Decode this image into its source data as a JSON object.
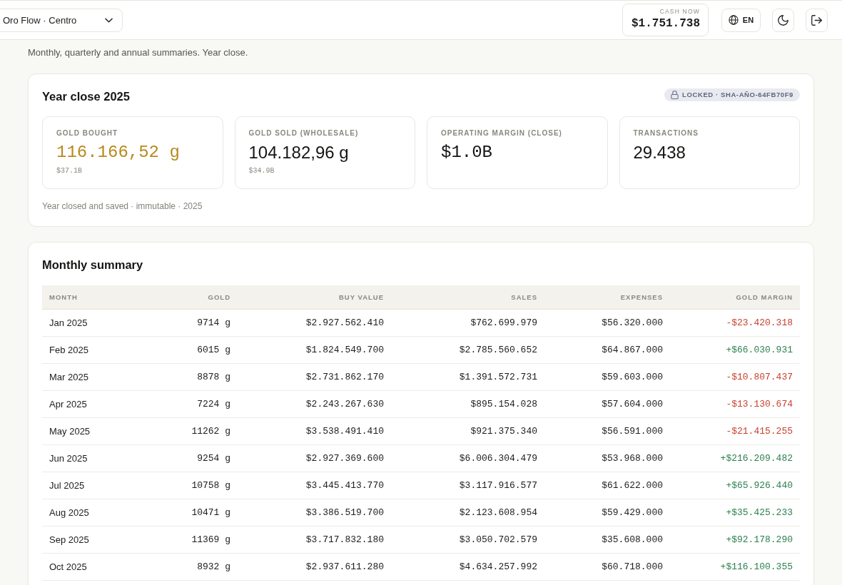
{
  "header": {
    "workspace_selector": "Oro Flow · Centro",
    "cash": {
      "label": "CASH NOW",
      "value": "$1.751.738"
    },
    "language": "EN"
  },
  "subtitle": "Monthly, quarterly and annual summaries. Year close.",
  "year_close": {
    "title": "Year close 2025",
    "lock_status": "LOCKED · SHA-AÑO-64FB70F9",
    "kpis": [
      {
        "kind": "highlight",
        "label": "GOLD BOUGHT",
        "value": "116.166,52 g",
        "sub": "$37.1B"
      },
      {
        "kind": "plain",
        "label": "GOLD SOLD (WHOLESALE)",
        "value": "104.182,96 g",
        "sub": "$34.9B"
      },
      {
        "kind": "money",
        "label": "OPERATING MARGIN (CLOSE)",
        "value": "$1.0B"
      },
      {
        "kind": "plain",
        "label": "TRANSACTIONS",
        "value": "29.438"
      }
    ],
    "note": "Year closed and saved · immutable · 2025"
  },
  "monthly": {
    "title": "Monthly summary",
    "columns": [
      "MONTH",
      "GOLD",
      "BUY VALUE",
      "SALES",
      "EXPENSES",
      "GOLD MARGIN"
    ],
    "rows": [
      {
        "month": "Jan 2025",
        "gold": "9714 g",
        "buy_value": "$2.927.562.410",
        "sales": "$762.699.979",
        "expenses": "$56.320.000",
        "gold_margin": "-$23.420.318",
        "negative": true
      },
      {
        "month": "Feb 2025",
        "gold": "6015 g",
        "buy_value": "$1.824.549.700",
        "sales": "$2.785.560.652",
        "expenses": "$64.867.000",
        "gold_margin": "+$66.030.931",
        "negative": false
      },
      {
        "month": "Mar 2025",
        "gold": "8878 g",
        "buy_value": "$2.731.862.170",
        "sales": "$1.391.572.731",
        "expenses": "$59.603.000",
        "gold_margin": "-$10.807.437",
        "negative": true
      },
      {
        "month": "Apr 2025",
        "gold": "7224 g",
        "buy_value": "$2.243.267.630",
        "sales": "$895.154.028",
        "expenses": "$57.604.000",
        "gold_margin": "-$13.130.674",
        "negative": true
      },
      {
        "month": "May 2025",
        "gold": "11262 g",
        "buy_value": "$3.538.491.410",
        "sales": "$921.375.340",
        "expenses": "$56.591.000",
        "gold_margin": "-$21.415.255",
        "negative": true
      },
      {
        "month": "Jun 2025",
        "gold": "9254 g",
        "buy_value": "$2.927.369.600",
        "sales": "$6.006.304.479",
        "expenses": "$53.968.000",
        "gold_margin": "+$216.209.482",
        "negative": false
      },
      {
        "month": "Jul 2025",
        "gold": "10758 g",
        "buy_value": "$3.445.413.770",
        "sales": "$3.117.916.577",
        "expenses": "$61.622.000",
        "gold_margin": "+$65.926.440",
        "negative": false
      },
      {
        "month": "Aug 2025",
        "gold": "10471 g",
        "buy_value": "$3.386.519.700",
        "sales": "$2.123.608.954",
        "expenses": "$59.429.000",
        "gold_margin": "+$35.425.233",
        "negative": false
      },
      {
        "month": "Sep 2025",
        "gold": "11369 g",
        "buy_value": "$3.717.832.180",
        "sales": "$3.050.702.579",
        "expenses": "$35.608.000",
        "gold_margin": "+$92.178.290",
        "negative": false
      },
      {
        "month": "Oct 2025",
        "gold": "8932 g",
        "buy_value": "$2.937.611.280",
        "sales": "$4.634.257.992",
        "expenses": "$60.718.000",
        "gold_margin": "+$116.100.355",
        "negative": false
      }
    ]
  }
}
